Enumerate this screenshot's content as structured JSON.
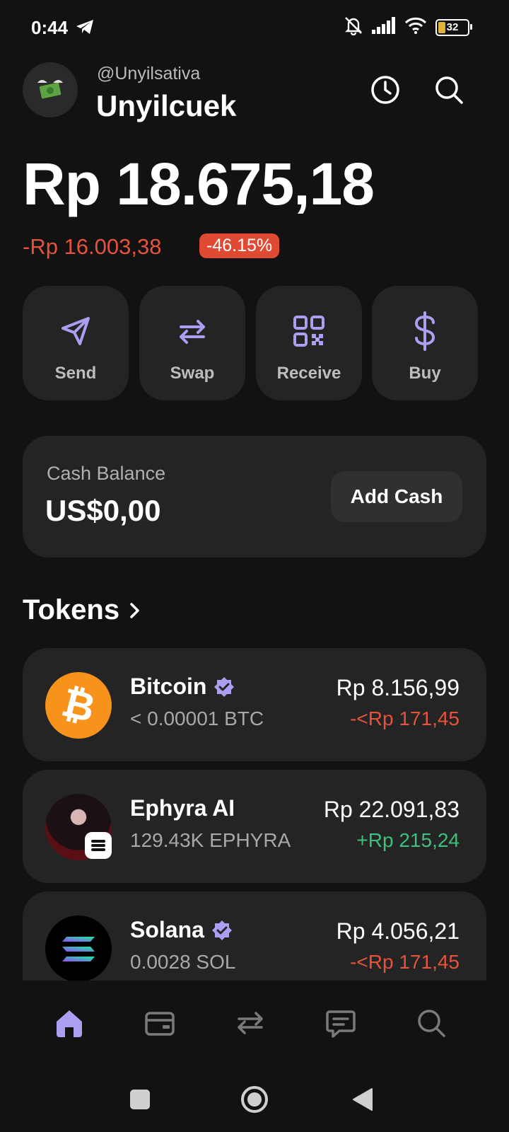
{
  "status_bar": {
    "time": "0:44",
    "battery": "32"
  },
  "header": {
    "handle": "@Unyilsativa",
    "name": "Unyilcuek"
  },
  "balance": {
    "amount": "Rp 18.675,18",
    "change": "-Rp 16.003,38",
    "change_pct": "-46.15%"
  },
  "actions": [
    {
      "label": "Send",
      "icon": "send-icon"
    },
    {
      "label": "Swap",
      "icon": "swap-icon"
    },
    {
      "label": "Receive",
      "icon": "qr-code-icon"
    },
    {
      "label": "Buy",
      "icon": "dollar-icon"
    }
  ],
  "cash": {
    "label": "Cash Balance",
    "value": "US$0,00",
    "button": "Add Cash"
  },
  "tokens": {
    "title": "Tokens",
    "items": [
      {
        "name": "Bitcoin",
        "amount": "< 0.00001 BTC",
        "value": "Rp 8.156,99",
        "change": "-<Rp 171,45",
        "direction": "down",
        "verified": true
      },
      {
        "name": "Ephyra AI",
        "amount": "129.43K EPHYRA",
        "value": "Rp 22.091,83",
        "change": "+Rp 215,24",
        "direction": "up",
        "verified": false
      },
      {
        "name": "Solana",
        "amount": "0.0028 SOL",
        "value": "Rp 4.056,21",
        "change": "-<Rp 171,45",
        "direction": "down",
        "verified": true
      }
    ]
  },
  "colors": {
    "accent": "#ab9ff2",
    "negative": "#e5523d",
    "positive": "#3fc07c",
    "card": "#242424"
  },
  "bottom_nav": [
    "home-icon",
    "wallet-icon",
    "swap-icon",
    "chat-icon",
    "search-icon"
  ]
}
